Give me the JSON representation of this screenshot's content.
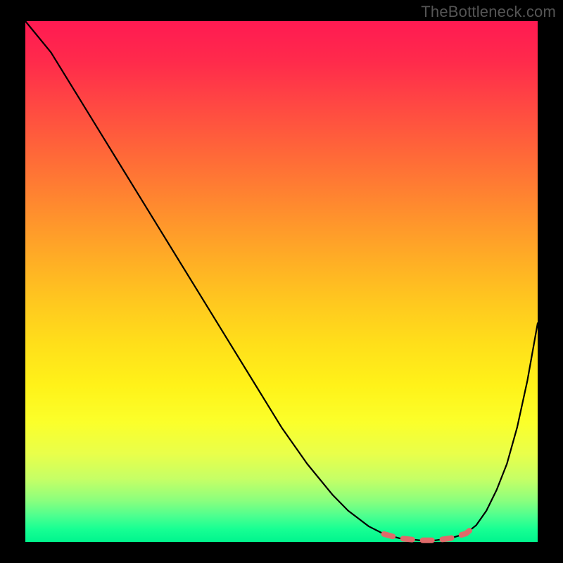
{
  "watermark": "TheBottleneck.com",
  "chart_data": {
    "type": "line",
    "title": "",
    "xlabel": "",
    "ylabel": "",
    "xlim": [
      0,
      100
    ],
    "ylim": [
      0,
      100
    ],
    "grid": false,
    "series": [
      {
        "name": "curve",
        "x": [
          0,
          5,
          10,
          15,
          20,
          25,
          30,
          35,
          40,
          45,
          50,
          55,
          60,
          63,
          67,
          70,
          73,
          77,
          80,
          83,
          86,
          88,
          90,
          92,
          94,
          96,
          98,
          100
        ],
        "y": [
          100,
          94,
          86,
          78,
          70,
          62,
          54,
          46,
          38,
          30,
          22,
          15,
          9,
          6,
          3,
          1.5,
          0.7,
          0.3,
          0.3,
          0.7,
          1.6,
          3.2,
          6,
          10,
          15,
          22,
          31,
          42
        ]
      }
    ],
    "annotations": [
      {
        "name": "min-region-dash",
        "x_range": [
          70,
          88
        ],
        "y_approx": 0.5
      }
    ]
  }
}
